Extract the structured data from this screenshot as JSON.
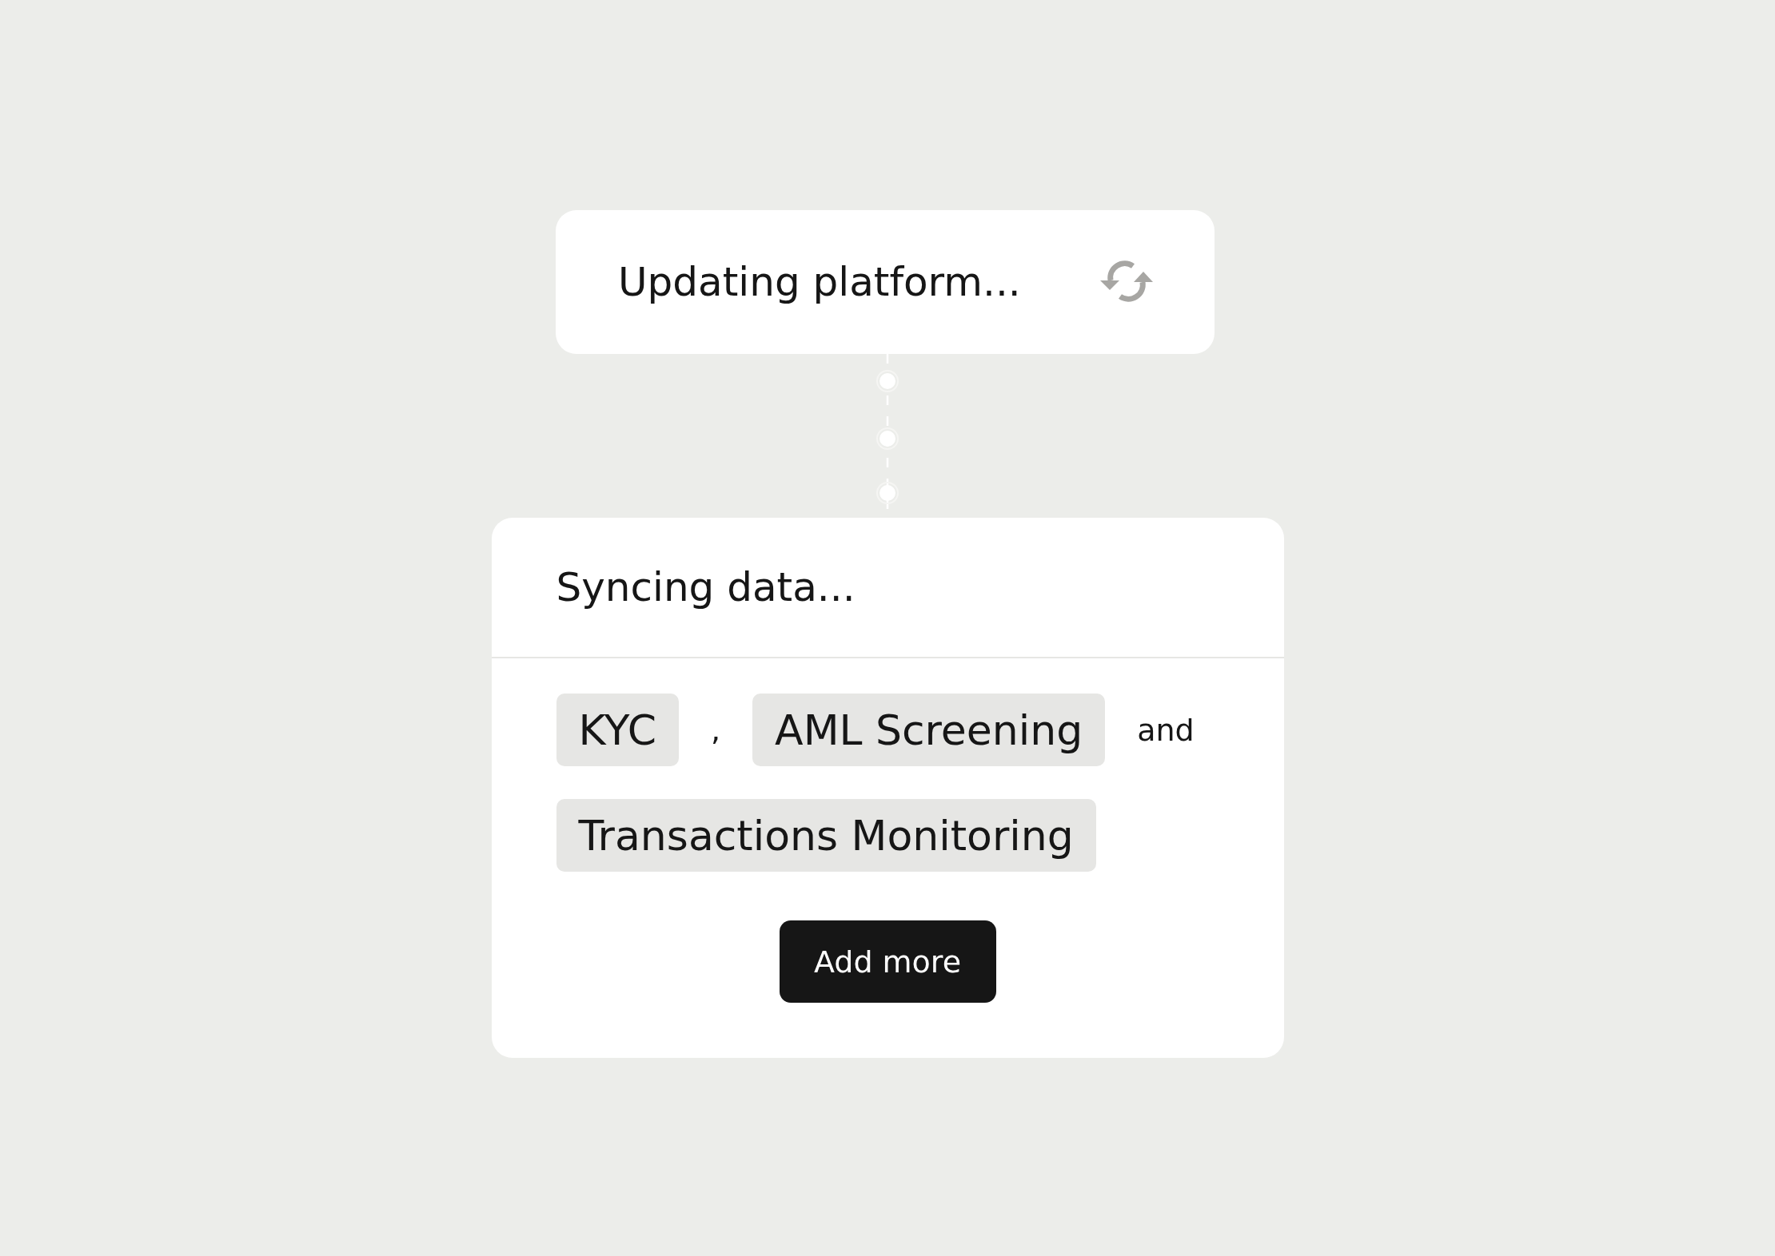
{
  "status_card": {
    "title": "Updating platform..."
  },
  "sync_card": {
    "title": "Syncing data...",
    "items": [
      {
        "kind": "chip",
        "text": "KYC"
      },
      {
        "kind": "separator",
        "text": ","
      },
      {
        "kind": "chip",
        "text": "AML Screening"
      },
      {
        "kind": "separator",
        "text": "and"
      },
      {
        "kind": "chip",
        "text": "Transactions Monitoring"
      }
    ],
    "button": "Add more"
  }
}
